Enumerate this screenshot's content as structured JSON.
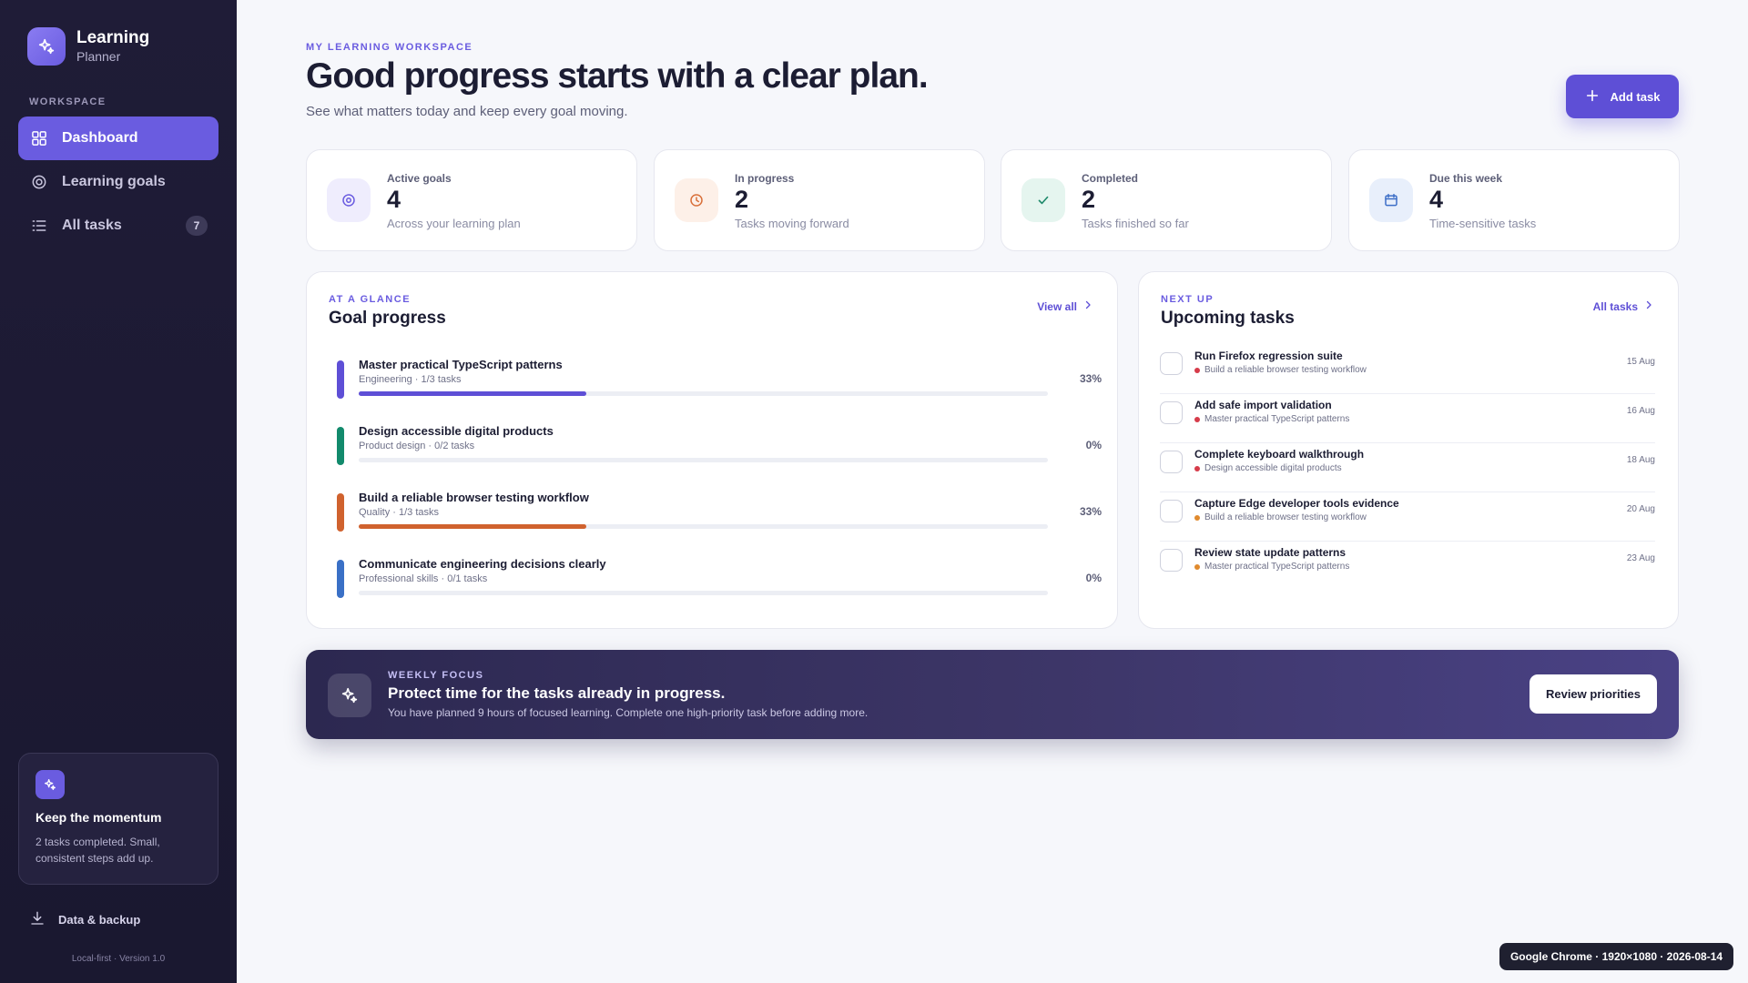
{
  "app": {
    "name": "Learning",
    "subtitle": "Planner"
  },
  "sidebar": {
    "section_label": "WORKSPACE",
    "items": [
      {
        "label": "Dashboard",
        "icon": "grid-icon",
        "active": true
      },
      {
        "label": "Learning goals",
        "icon": "target-icon"
      },
      {
        "label": "All tasks",
        "icon": "list-icon",
        "badge": "7"
      }
    ],
    "momentum": {
      "title": "Keep the momentum",
      "text": "2 tasks completed. Small, consistent steps add up."
    },
    "backup_label": "Data & backup",
    "version": "Local-first · Version 1.0"
  },
  "header": {
    "eyebrow": "MY LEARNING WORKSPACE",
    "title": "Good progress starts with a clear plan.",
    "subtitle": "See what matters today and keep every goal moving.",
    "add_button": "Add task"
  },
  "stats": [
    {
      "label": "Active goals",
      "value": "4",
      "sub": "Across your learning plan",
      "icon": "target-icon",
      "accent": "#6a5ce0",
      "bg": "#efedfd"
    },
    {
      "label": "In progress",
      "value": "2",
      "sub": "Tasks moving forward",
      "icon": "clock-icon",
      "accent": "#d9703a",
      "bg": "#fdf0e8"
    },
    {
      "label": "Completed",
      "value": "2",
      "sub": "Tasks finished so far",
      "icon": "check-icon",
      "accent": "#1f8a6b",
      "bg": "#e5f5ef"
    },
    {
      "label": "Due this week",
      "value": "4",
      "sub": "Time-sensitive tasks",
      "icon": "calendar-icon",
      "accent": "#3d6fc7",
      "bg": "#e8effb"
    }
  ],
  "goals_card": {
    "eyebrow": "AT A GLANCE",
    "title": "Goal progress",
    "link": "View all",
    "goals": [
      {
        "name": "Master practical TypeScript patterns",
        "meta": "Engineering · 1/3 tasks",
        "pct": "33%",
        "progress": 0.33,
        "color": "#5e4fd6"
      },
      {
        "name": "Design accessible digital products",
        "meta": "Product design · 0/2 tasks",
        "pct": "0%",
        "progress": 0,
        "color": "#128a6c"
      },
      {
        "name": "Build a reliable browser testing workflow",
        "meta": "Quality · 1/3 tasks",
        "pct": "33%",
        "progress": 0.33,
        "color": "#d0622e"
      },
      {
        "name": "Communicate engineering decisions clearly",
        "meta": "Professional skills · 0/1 tasks",
        "pct": "0%",
        "progress": 0,
        "color": "#3a70c6"
      }
    ]
  },
  "tasks_card": {
    "eyebrow": "NEXT UP",
    "title": "Upcoming tasks",
    "link": "All tasks",
    "tasks": [
      {
        "name": "Run Firefox regression suite",
        "goal": "Build a reliable browser testing workflow",
        "date": "15 Aug",
        "dot": "#d63b4a"
      },
      {
        "name": "Add safe import validation",
        "goal": "Master practical TypeScript patterns",
        "date": "16 Aug",
        "dot": "#d63b4a"
      },
      {
        "name": "Complete keyboard walkthrough",
        "goal": "Design accessible digital products",
        "date": "18 Aug",
        "dot": "#d63b4a"
      },
      {
        "name": "Capture Edge developer tools evidence",
        "goal": "Build a reliable browser testing workflow",
        "date": "20 Aug",
        "dot": "#e08a2e"
      },
      {
        "name": "Review state update patterns",
        "goal": "Master practical TypeScript patterns",
        "date": "23 Aug",
        "dot": "#e08a2e"
      }
    ]
  },
  "focus": {
    "eyebrow": "WEEKLY FOCUS",
    "title": "Protect time for the tasks already in progress.",
    "subtitle": "You have planned 9 hours of focused learning. Complete one high-priority task before adding more.",
    "button": "Review priorities"
  },
  "browser_tag": "Google Chrome · 1920×1080 · 2026-08-14"
}
